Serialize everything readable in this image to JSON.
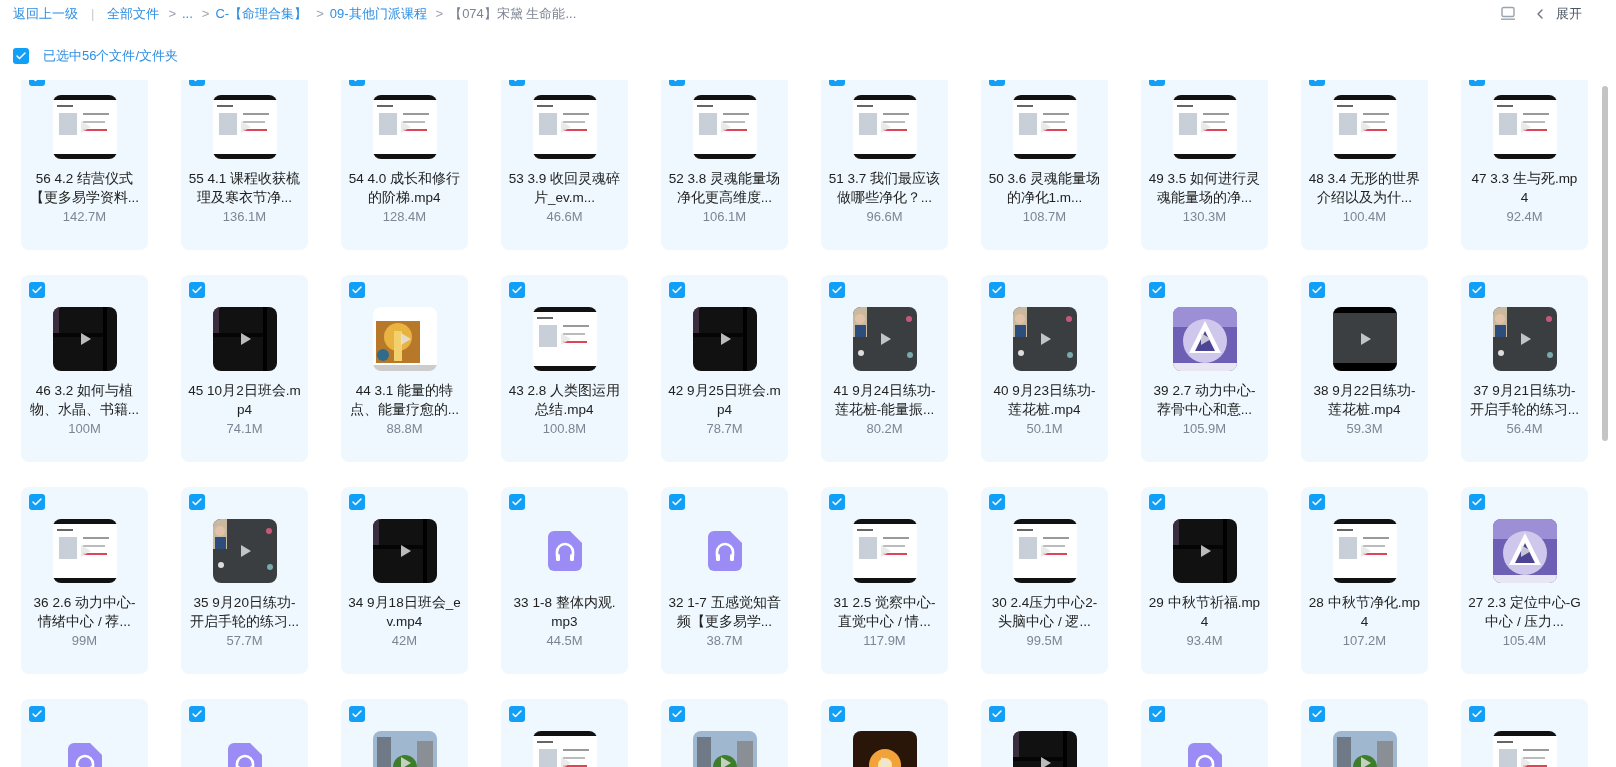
{
  "breadcrumb": [
    {
      "kind": "link",
      "text": "返回上一级"
    },
    {
      "kind": "divider",
      "text": "|"
    },
    {
      "kind": "link",
      "text": "全部文件"
    },
    {
      "kind": "separator",
      "text": ">"
    },
    {
      "kind": "link",
      "text": "..."
    },
    {
      "kind": "separator",
      "text": ">"
    },
    {
      "kind": "link",
      "text": "C-【命理合集】"
    },
    {
      "kind": "separator",
      "text": ">"
    },
    {
      "kind": "link",
      "text": "09-其他门派课程"
    },
    {
      "kind": "separator",
      "text": ">"
    },
    {
      "kind": "current",
      "text": "【074】宋黛 生命能..."
    }
  ],
  "toolbar": {
    "expand_label": "展开"
  },
  "selection": {
    "checked": true,
    "label": "已选中56个文件/文件夹"
  },
  "files": [
    {
      "kind": "video",
      "checked": true,
      "name": "56 4.2 结营仪式【更多易学资料...",
      "size": "142.7M"
    },
    {
      "kind": "video",
      "checked": true,
      "name": "55 4.1 课程收获梳理及寒衣节净...",
      "size": "136.1M"
    },
    {
      "kind": "video",
      "checked": true,
      "name": "54 4.0 成长和修行的阶梯.mp4",
      "size": "128.4M"
    },
    {
      "kind": "video",
      "checked": true,
      "name": "53 3.9 收回灵魂碎片_ev.m...",
      "size": "46.6M"
    },
    {
      "kind": "video",
      "checked": true,
      "name": "52 3.8 灵魂能量场净化更高维度...",
      "size": "106.1M"
    },
    {
      "kind": "video",
      "checked": true,
      "name": "51 3.7 我们最应该做哪些净化？...",
      "size": "96.6M"
    },
    {
      "kind": "video",
      "checked": true,
      "name": "50 3.6 灵魂能量场的净化1.m...",
      "size": "108.7M"
    },
    {
      "kind": "video",
      "checked": true,
      "name": "49 3.5 如何进行灵魂能量场的净...",
      "size": "130.3M"
    },
    {
      "kind": "video",
      "checked": true,
      "name": "48 3.4 无形的世界介绍以及为什...",
      "size": "100.4M"
    },
    {
      "kind": "video",
      "checked": true,
      "name": "47 3.3 生与死.mp4",
      "size": "92.4M"
    },
    {
      "kind": "video",
      "checked": true,
      "name": "46 3.2 如何与植物、水晶、书籍...",
      "size": "100M"
    },
    {
      "kind": "video",
      "checked": true,
      "name": "45 10月2日班会.mp4",
      "size": "74.1M"
    },
    {
      "kind": "video",
      "checked": true,
      "name": "44 3.1 能量的特点、能量疗愈的...",
      "size": "88.8M"
    },
    {
      "kind": "video",
      "checked": true,
      "name": "43 2.8 人类图运用总结.mp4",
      "size": "100.8M"
    },
    {
      "kind": "video",
      "checked": true,
      "name": "42 9月25日班会.mp4",
      "size": "78.7M"
    },
    {
      "kind": "video",
      "checked": true,
      "name": "41 9月24日练功-莲花桩-能量振...",
      "size": "80.2M"
    },
    {
      "kind": "video",
      "checked": true,
      "name": "40 9月23日练功-莲花桩.mp4",
      "size": "50.1M"
    },
    {
      "kind": "video",
      "checked": true,
      "name": "39 2.7 动力中心-荐骨中心和意...",
      "size": "105.9M"
    },
    {
      "kind": "video",
      "checked": true,
      "name": "38 9月22日练功-莲花桩.mp4",
      "size": "59.3M"
    },
    {
      "kind": "video",
      "checked": true,
      "name": "37 9月21日练功-开启手轮的练习...",
      "size": "56.4M"
    },
    {
      "kind": "video",
      "checked": true,
      "name": "36 2.6 动力中心-情绪中心 / 荐...",
      "size": "99M"
    },
    {
      "kind": "video",
      "checked": true,
      "name": "35 9月20日练功-开启手轮的练习...",
      "size": "57.7M"
    },
    {
      "kind": "video",
      "checked": true,
      "name": "34 9月18日班会_ev.mp4",
      "size": "42M"
    },
    {
      "kind": "audio",
      "checked": true,
      "name": "33 1-8 整体内观.mp3",
      "size": "44.5M"
    },
    {
      "kind": "audio",
      "checked": true,
      "name": "32 1-7 五感觉知音频【更多易学...",
      "size": "38.7M"
    },
    {
      "kind": "video",
      "checked": true,
      "name": "31 2.5 觉察中心-直觉中心 / 情...",
      "size": "117.9M"
    },
    {
      "kind": "video",
      "checked": true,
      "name": "30 2.4压力中心2-头脑中心 / 逻...",
      "size": "99.5M"
    },
    {
      "kind": "video",
      "checked": true,
      "name": "29 中秋节祈福.mp4",
      "size": "93.4M"
    },
    {
      "kind": "video",
      "checked": true,
      "name": "28 中秋节净化.mp4",
      "size": "107.2M"
    },
    {
      "kind": "video",
      "checked": true,
      "name": "27 2.3 定位中心-G中心 / 压力...",
      "size": "105.4M"
    },
    {
      "kind": "audio",
      "checked": true
    },
    {
      "kind": "audio",
      "checked": true
    },
    {
      "kind": "video",
      "checked": true
    },
    {
      "kind": "video",
      "checked": true
    },
    {
      "kind": "video",
      "checked": true
    },
    {
      "kind": "video",
      "checked": true
    },
    {
      "kind": "video",
      "checked": true
    },
    {
      "kind": "audio",
      "checked": true
    },
    {
      "kind": "video",
      "checked": true
    },
    {
      "kind": "video",
      "checked": true
    }
  ]
}
